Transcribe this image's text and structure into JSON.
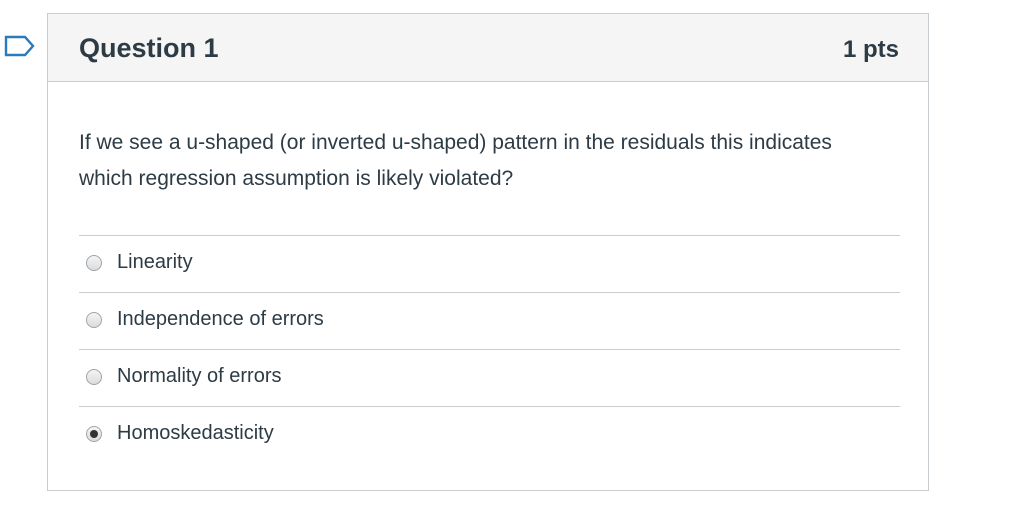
{
  "question": {
    "flag_icon": "bookmark-flag-icon",
    "title": "Question 1",
    "points": "1 pts",
    "text": "If we see a u-shaped (or inverted u-shaped) pattern in the residuals this indicates which regression assumption is likely violated?",
    "answers": [
      {
        "label": "Linearity",
        "selected": false
      },
      {
        "label": "Independence of errors",
        "selected": false
      },
      {
        "label": "Normality of errors",
        "selected": false
      },
      {
        "label": "Homoskedasticity",
        "selected": true
      }
    ]
  },
  "colors": {
    "border": "#c7cdd1",
    "header_bg": "#f5f5f5",
    "text": "#2d3b45",
    "flag": "#2b7abc"
  }
}
